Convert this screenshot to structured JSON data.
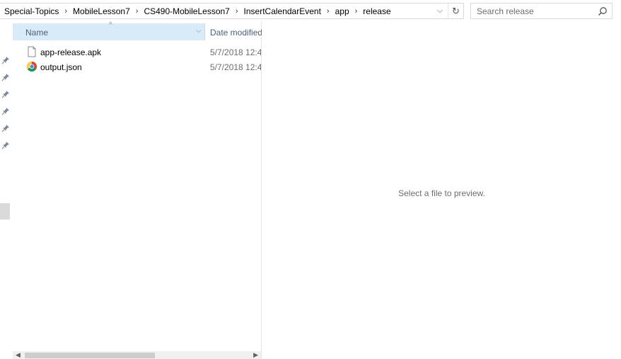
{
  "address_bar": {
    "breadcrumbs": [
      {
        "label": "Special-Topics"
      },
      {
        "label": "MobileLesson7"
      },
      {
        "label": "CS490-MobileLesson7"
      },
      {
        "label": "InsertCalendarEvent"
      },
      {
        "label": "app"
      },
      {
        "label": "release"
      }
    ],
    "separator": "›",
    "dropdown_icon": "chevron-down-icon",
    "refresh_icon": "refresh-icon"
  },
  "search": {
    "placeholder": "Search release",
    "value": "",
    "icon": "search-icon"
  },
  "file_list": {
    "columns": [
      {
        "label": "Name",
        "sorted": "ascending"
      },
      {
        "label": "Date modified"
      }
    ],
    "rows": [
      {
        "name": "app-release.apk",
        "date": "5/7/2018 12:4",
        "icon": "file-generic-icon"
      },
      {
        "name": "output.json",
        "date": "5/7/2018 12:4",
        "icon": "chrome-icon"
      }
    ]
  },
  "preview": {
    "message": "Select a file to preview."
  },
  "colors": {
    "header_highlight": "#d9ebf9",
    "header_text": "#4c607a",
    "secondary_text": "#6d6d6d"
  }
}
